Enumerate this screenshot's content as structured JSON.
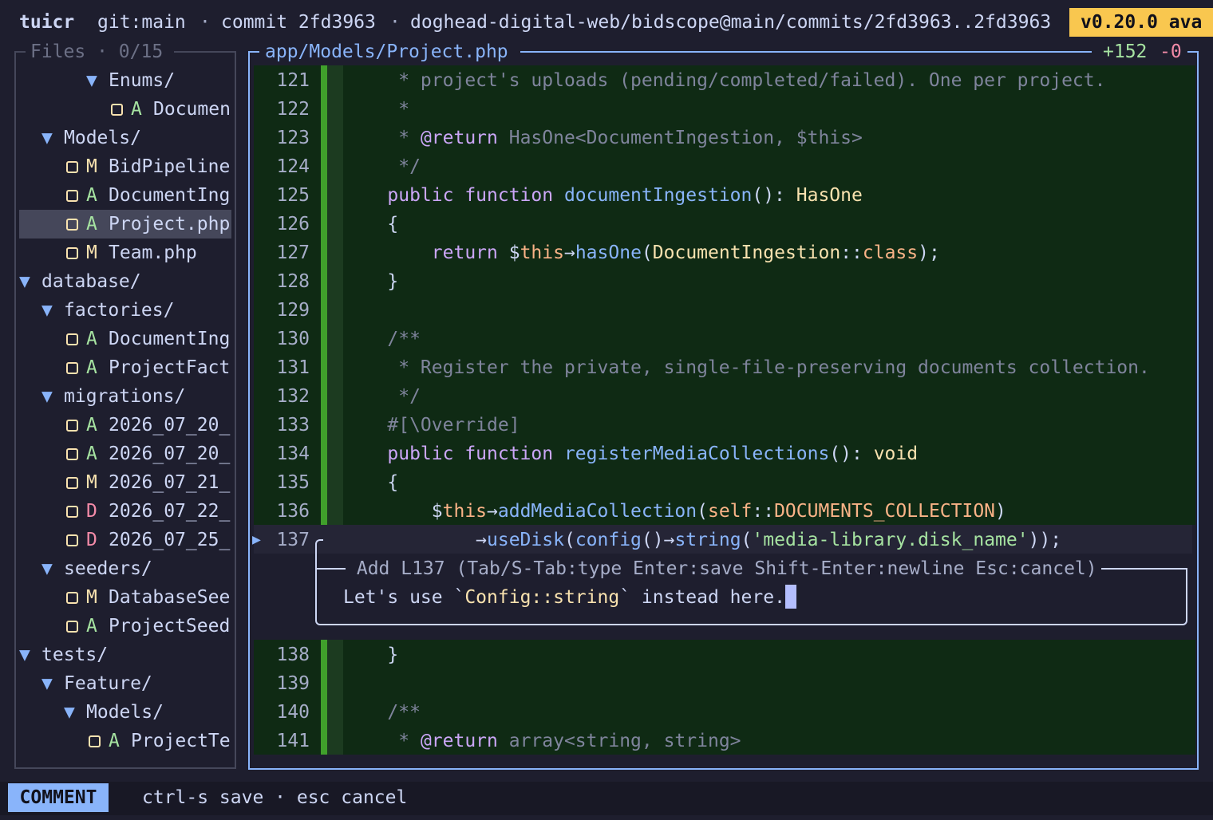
{
  "topbar": {
    "app": "tuicr",
    "branch": "git:main",
    "sep1": "·",
    "commit": "commit 2fd3963",
    "sep2": "·",
    "path": "doghead-digital-web/bidscope@main/commits/2fd3963..2fd3963",
    "version": "v0.20.0 ava"
  },
  "sidebar": {
    "title": "Files · 0/15",
    "items": [
      {
        "indent": 3,
        "type": "dir",
        "icon": "▼",
        "label": "Enums/"
      },
      {
        "indent": 4,
        "type": "file",
        "status": "A",
        "label": "Documen"
      },
      {
        "indent": 1,
        "type": "dir",
        "icon": "▼",
        "label": "Models/"
      },
      {
        "indent": 2,
        "type": "file",
        "status": "M",
        "label": "BidPipeline"
      },
      {
        "indent": 2,
        "type": "file",
        "status": "A",
        "label": "DocumentIng"
      },
      {
        "indent": 2,
        "type": "file",
        "status": "A",
        "label": "Project.php",
        "selected": true
      },
      {
        "indent": 2,
        "type": "file",
        "status": "M",
        "label": "Team.php"
      },
      {
        "indent": 0,
        "type": "dir",
        "icon": "▼",
        "label": "database/"
      },
      {
        "indent": 1,
        "type": "dir",
        "icon": "▼",
        "label": "factories/"
      },
      {
        "indent": 2,
        "type": "file",
        "status": "A",
        "label": "DocumentIng"
      },
      {
        "indent": 2,
        "type": "file",
        "status": "A",
        "label": "ProjectFact"
      },
      {
        "indent": 1,
        "type": "dir",
        "icon": "▼",
        "label": "migrations/"
      },
      {
        "indent": 2,
        "type": "file",
        "status": "A",
        "label": "2026_07_20_"
      },
      {
        "indent": 2,
        "type": "file",
        "status": "A",
        "label": "2026_07_20_"
      },
      {
        "indent": 2,
        "type": "file",
        "status": "M",
        "label": "2026_07_21_"
      },
      {
        "indent": 2,
        "type": "file",
        "status": "D",
        "label": "2026_07_22_"
      },
      {
        "indent": 2,
        "type": "file",
        "status": "D",
        "label": "2026_07_25_"
      },
      {
        "indent": 1,
        "type": "dir",
        "icon": "▼",
        "label": "seeders/"
      },
      {
        "indent": 2,
        "type": "file",
        "status": "M",
        "label": "DatabaseSee"
      },
      {
        "indent": 2,
        "type": "file",
        "status": "A",
        "label": "ProjectSeed"
      },
      {
        "indent": 0,
        "type": "dir",
        "icon": "▼",
        "label": "tests/"
      },
      {
        "indent": 1,
        "type": "dir",
        "icon": "▼",
        "label": "Feature/"
      },
      {
        "indent": 2,
        "type": "dir",
        "icon": "▼",
        "label": "Models/"
      },
      {
        "indent": 3,
        "type": "file",
        "status": "A",
        "label": "ProjectTe"
      }
    ]
  },
  "diff": {
    "file": "app/Models/Project.php",
    "added": "+152",
    "removed": "-0",
    "lines_before": [
      {
        "n": "121",
        "segs": [
          [
            "cm",
            "     * project's uploads (pending/completed/failed). One per project."
          ]
        ]
      },
      {
        "n": "122",
        "segs": [
          [
            "cm",
            "     *"
          ]
        ]
      },
      {
        "n": "123",
        "segs": [
          [
            "cm",
            "     * "
          ],
          [
            "kw",
            "@return"
          ],
          [
            "cm",
            " HasOne<DocumentIngestion, $this>"
          ]
        ]
      },
      {
        "n": "124",
        "segs": [
          [
            "cm",
            "     */"
          ]
        ]
      },
      {
        "n": "125",
        "segs": [
          [
            "kw",
            "    public function "
          ],
          [
            "fn",
            "documentIngestion"
          ],
          [
            "pl",
            "(): "
          ],
          [
            "ty",
            "HasOne"
          ]
        ]
      },
      {
        "n": "126",
        "segs": [
          [
            "pl",
            "    {"
          ]
        ]
      },
      {
        "n": "127",
        "segs": [
          [
            "kw",
            "        return "
          ],
          [
            "pl",
            "$"
          ],
          [
            "kw2",
            "this"
          ],
          [
            "pl",
            "→"
          ],
          [
            "fn",
            "hasOne"
          ],
          [
            "pl",
            "("
          ],
          [
            "ty",
            "DocumentIngestion"
          ],
          [
            "pl",
            "::"
          ],
          [
            "kw2",
            "class"
          ],
          [
            "pl",
            ");"
          ]
        ]
      },
      {
        "n": "128",
        "segs": [
          [
            "pl",
            "    }"
          ]
        ]
      },
      {
        "n": "129",
        "segs": [
          [
            "pl",
            ""
          ]
        ]
      },
      {
        "n": "130",
        "segs": [
          [
            "cm",
            "    /**"
          ]
        ]
      },
      {
        "n": "131",
        "segs": [
          [
            "cm",
            "     * Register the private, single-file-preserving documents collection."
          ]
        ]
      },
      {
        "n": "132",
        "segs": [
          [
            "cm",
            "     */"
          ]
        ]
      },
      {
        "n": "133",
        "segs": [
          [
            "cm",
            "    #[\\Override]"
          ]
        ]
      },
      {
        "n": "134",
        "segs": [
          [
            "kw",
            "    public function "
          ],
          [
            "fn",
            "registerMediaCollections"
          ],
          [
            "pl",
            "(): "
          ],
          [
            "ty",
            "void"
          ]
        ]
      },
      {
        "n": "135",
        "segs": [
          [
            "pl",
            "    {"
          ]
        ]
      },
      {
        "n": "136",
        "segs": [
          [
            "pl",
            "        $"
          ],
          [
            "kw2",
            "this"
          ],
          [
            "pl",
            "→"
          ],
          [
            "fn",
            "addMediaCollection"
          ],
          [
            "pl",
            "("
          ],
          [
            "kw2",
            "self"
          ],
          [
            "pl",
            "::"
          ],
          [
            "kw2",
            "DOCUMENTS_COLLECTION"
          ],
          [
            "pl",
            ")"
          ]
        ]
      }
    ],
    "current_line": {
      "n": "137",
      "marker": "▶",
      "segs": [
        [
          "pl",
          "            →"
        ],
        [
          "fn",
          "useDisk"
        ],
        [
          "pl",
          "("
        ],
        [
          "fn",
          "config"
        ],
        [
          "pl",
          "()→"
        ],
        [
          "fn",
          "string"
        ],
        [
          "pl",
          "("
        ],
        [
          "st",
          "'media-library.disk_name'"
        ],
        [
          "pl",
          "));"
        ]
      ]
    },
    "lines_after": [
      {
        "n": "138",
        "segs": [
          [
            "pl",
            "    }"
          ]
        ]
      },
      {
        "n": "139",
        "segs": [
          [
            "pl",
            ""
          ]
        ]
      },
      {
        "n": "140",
        "segs": [
          [
            "cm",
            "    /**"
          ]
        ]
      },
      {
        "n": "141",
        "segs": [
          [
            "cm",
            "     * "
          ],
          [
            "kw",
            "@return"
          ],
          [
            "cm",
            " array<string, string>"
          ]
        ]
      }
    ]
  },
  "comment_box": {
    "title": " Add L137 (Tab/S-Tab:type Enter:save Shift-Enter:newline Esc:cancel)",
    "text_before": "Let's use `",
    "text_code": "Config::string",
    "text_after": "` instead here."
  },
  "statusbar": {
    "mode": "COMMENT",
    "hints": "ctrl-s save · esc cancel"
  },
  "colors": {
    "accent": "#89b4fa",
    "added_bg": "#0f2a14",
    "added_bar": "#40a02b",
    "status_A": "#a6e3a1",
    "status_M": "#f9e2af",
    "status_D": "#f38ba8"
  }
}
